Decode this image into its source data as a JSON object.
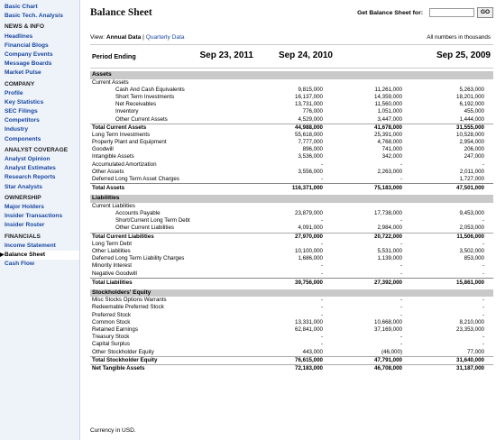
{
  "sidebar": {
    "items": [
      {
        "type": "link",
        "label": "Basic Chart"
      },
      {
        "type": "link",
        "label": "Basic Tech. Analysis"
      },
      {
        "type": "sec",
        "label": "NEWS & INFO"
      },
      {
        "type": "link",
        "label": "Headlines"
      },
      {
        "type": "link",
        "label": "Financial Blogs"
      },
      {
        "type": "link",
        "label": "Company Events"
      },
      {
        "type": "link",
        "label": "Message Boards"
      },
      {
        "type": "link",
        "label": "Market Pulse"
      },
      {
        "type": "sec",
        "label": "COMPANY"
      },
      {
        "type": "link",
        "label": "Profile"
      },
      {
        "type": "link",
        "label": "Key Statistics"
      },
      {
        "type": "link",
        "label": "SEC Filings"
      },
      {
        "type": "link",
        "label": "Competitors"
      },
      {
        "type": "link",
        "label": "Industry"
      },
      {
        "type": "link",
        "label": "Components"
      },
      {
        "type": "sec",
        "label": "ANALYST COVERAGE"
      },
      {
        "type": "link",
        "label": "Analyst Opinion"
      },
      {
        "type": "link",
        "label": "Analyst Estimates"
      },
      {
        "type": "link",
        "label": "Research Reports"
      },
      {
        "type": "link",
        "label": "Star Analysts"
      },
      {
        "type": "sec",
        "label": "OWNERSHIP"
      },
      {
        "type": "link",
        "label": "Major Holders"
      },
      {
        "type": "link",
        "label": "Insider Transactions"
      },
      {
        "type": "link",
        "label": "Insider Roster"
      },
      {
        "type": "sec",
        "label": "FINANCIALS"
      },
      {
        "type": "link",
        "label": "Income Statement"
      },
      {
        "type": "link",
        "label": "Balance Sheet",
        "active": true
      },
      {
        "type": "link",
        "label": "Cash Flow"
      }
    ]
  },
  "header": {
    "title": "Balance Sheet",
    "get_label": "Get Balance Sheet for:",
    "input_value": "",
    "go_label": "GO"
  },
  "view": {
    "prefix": "View: ",
    "annual": "Annual Data",
    "sep": " | ",
    "quarterly": "Quarterly Data",
    "note": "All numbers in thousands"
  },
  "period": {
    "label": "Period Ending",
    "dates": [
      "Sep 23, 2011",
      "Sep 24, 2010",
      "Sep 25, 2009"
    ]
  },
  "rows": [
    {
      "t": "hdr",
      "label": "Assets"
    },
    {
      "t": "row",
      "label": "Current Assets",
      "vals": [
        "",
        "",
        ""
      ]
    },
    {
      "t": "row",
      "indent": true,
      "label": "Cash And Cash Equivalents",
      "vals": [
        "9,815,000",
        "11,261,000",
        "5,263,000"
      ]
    },
    {
      "t": "row",
      "indent": true,
      "label": "Short Term Investments",
      "vals": [
        "16,137,000",
        "14,359,000",
        "18,201,000"
      ]
    },
    {
      "t": "row",
      "indent": true,
      "label": "Net Receivables",
      "vals": [
        "13,731,000",
        "11,560,000",
        "6,192,000"
      ]
    },
    {
      "t": "row",
      "indent": true,
      "label": "Inventory",
      "vals": [
        "776,000",
        "1,051,000",
        "455,000"
      ]
    },
    {
      "t": "row",
      "indent": true,
      "label": "Other Current Assets",
      "vals": [
        "4,529,000",
        "3,447,000",
        "1,444,000"
      ]
    },
    {
      "t": "line",
      "label": "Total Current Assets",
      "vals": [
        "44,988,000",
        "41,678,000",
        "31,555,000"
      ]
    },
    {
      "t": "row",
      "label": "Long Term Investments",
      "vals": [
        "55,618,000",
        "25,391,000",
        "10,528,000"
      ]
    },
    {
      "t": "row",
      "label": "Property Plant and Equipment",
      "vals": [
        "7,777,000",
        "4,768,000",
        "2,954,000"
      ]
    },
    {
      "t": "row",
      "label": "Goodwill",
      "vals": [
        "896,000",
        "741,000",
        "206,000"
      ]
    },
    {
      "t": "row",
      "label": "Intangible Assets",
      "vals": [
        "3,536,000",
        "342,000",
        "247,000"
      ]
    },
    {
      "t": "row",
      "label": "Accumulated Amortization",
      "vals": [
        "-",
        "-",
        "-"
      ]
    },
    {
      "t": "row",
      "label": "Other Assets",
      "vals": [
        "3,556,000",
        "2,263,000",
        "2,011,000"
      ]
    },
    {
      "t": "row",
      "label": "Deferred Long Term Asset Charges",
      "vals": [
        "-",
        "-",
        "1,727,000"
      ]
    },
    {
      "t": "tot",
      "label": "Total Assets",
      "vals": [
        "116,371,000",
        "75,183,000",
        "47,501,000"
      ]
    },
    {
      "t": "hdr",
      "label": "Liabilities"
    },
    {
      "t": "row",
      "label": "Current Liabilities",
      "vals": [
        "",
        "",
        ""
      ]
    },
    {
      "t": "row",
      "indent": true,
      "label": "Accounts Payable",
      "vals": [
        "23,879,000",
        "17,738,000",
        "9,453,000"
      ]
    },
    {
      "t": "row",
      "indent": true,
      "label": "Short/Current Long Term Debt",
      "vals": [
        "-",
        "-",
        "-"
      ]
    },
    {
      "t": "row",
      "indent": true,
      "label": "Other Current Liabilities",
      "vals": [
        "4,091,000",
        "2,984,000",
        "2,053,000"
      ]
    },
    {
      "t": "line",
      "label": "Total Current Liabilities",
      "vals": [
        "27,970,000",
        "20,722,000",
        "11,506,000"
      ]
    },
    {
      "t": "row",
      "label": "Long Term Debt",
      "vals": [
        "-",
        "-",
        "-"
      ]
    },
    {
      "t": "row",
      "label": "Other Liabilities",
      "vals": [
        "10,100,000",
        "5,531,000",
        "3,502,000"
      ]
    },
    {
      "t": "row",
      "label": "Deferred Long Term Liability Charges",
      "vals": [
        "1,686,000",
        "1,139,000",
        "853,000"
      ]
    },
    {
      "t": "row",
      "label": "Minority Interest",
      "vals": [
        "-",
        "-",
        "-"
      ]
    },
    {
      "t": "row",
      "label": "Negative Goodwill",
      "vals": [
        "-",
        "-",
        "-"
      ]
    },
    {
      "t": "tot",
      "label": "Total Liabilities",
      "vals": [
        "39,756,000",
        "27,392,000",
        "15,861,000"
      ]
    },
    {
      "t": "hdr",
      "label": "Stockholders' Equity"
    },
    {
      "t": "row",
      "label": "Misc Stocks Options Warrants",
      "vals": [
        "-",
        "-",
        "-"
      ]
    },
    {
      "t": "row",
      "label": "Redeemable Preferred Stock",
      "vals": [
        "-",
        "-",
        "-"
      ]
    },
    {
      "t": "row",
      "label": "Preferred Stock",
      "vals": [
        "-",
        "-",
        "-"
      ]
    },
    {
      "t": "row",
      "label": "Common Stock",
      "vals": [
        "13,331,000",
        "10,668,000",
        "8,210,000"
      ]
    },
    {
      "t": "row",
      "label": "Retained Earnings",
      "vals": [
        "62,841,000",
        "37,169,000",
        "23,353,000"
      ]
    },
    {
      "t": "row",
      "label": "Treasury Stock",
      "vals": [
        "-",
        "-",
        "-"
      ]
    },
    {
      "t": "row",
      "label": "Capital Surplus",
      "vals": [
        "-",
        "-",
        "-"
      ]
    },
    {
      "t": "row",
      "label": "Other Stockholder Equity",
      "vals": [
        "443,000",
        "(46,000)",
        "77,000"
      ]
    },
    {
      "t": "line",
      "label": "Total Stockholder Equity",
      "vals": [
        "76,615,000",
        "47,791,000",
        "31,640,000"
      ]
    },
    {
      "t": "line",
      "label": "Net Tangible Assets",
      "vals": [
        "72,183,000",
        "46,708,000",
        "31,187,000"
      ]
    }
  ],
  "footer": "Currency in USD."
}
